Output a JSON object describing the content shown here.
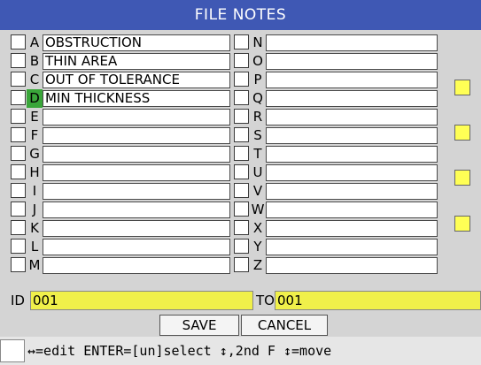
{
  "title": "FILE NOTES",
  "left_notes": [
    {
      "letter": "A",
      "text": "OBSTRUCTION"
    },
    {
      "letter": "B",
      "text": "THIN AREA"
    },
    {
      "letter": "C",
      "text": "OUT OF TOLERANCE"
    },
    {
      "letter": "D",
      "text": "MIN THICKNESS",
      "selected": true
    },
    {
      "letter": "E",
      "text": ""
    },
    {
      "letter": "F",
      "text": ""
    },
    {
      "letter": "G",
      "text": ""
    },
    {
      "letter": "H",
      "text": ""
    },
    {
      "letter": "I",
      "text": ""
    },
    {
      "letter": "J",
      "text": ""
    },
    {
      "letter": "K",
      "text": ""
    },
    {
      "letter": "L",
      "text": ""
    },
    {
      "letter": "M",
      "text": ""
    }
  ],
  "right_notes": [
    {
      "letter": "N",
      "text": ""
    },
    {
      "letter": "O",
      "text": ""
    },
    {
      "letter": "P",
      "text": ""
    },
    {
      "letter": "Q",
      "text": ""
    },
    {
      "letter": "R",
      "text": ""
    },
    {
      "letter": "S",
      "text": ""
    },
    {
      "letter": "T",
      "text": ""
    },
    {
      "letter": "U",
      "text": ""
    },
    {
      "letter": "V",
      "text": ""
    },
    {
      "letter": "W",
      "text": ""
    },
    {
      "letter": "X",
      "text": ""
    },
    {
      "letter": "Y",
      "text": ""
    },
    {
      "letter": "Z",
      "text": ""
    }
  ],
  "id_range": {
    "id_label": "ID",
    "id_value": "001",
    "to_label": "TO",
    "to_value": "001"
  },
  "buttons": {
    "save": "SAVE",
    "cancel": "CANCEL"
  },
  "status": {
    "help_text": "↔=edit ENTER=[un]select ↕,2nd F ↕=move"
  },
  "colors": {
    "title_bar": "#3f58b4",
    "selected_letter": "#3aa63a",
    "id_field": "#f0f04a",
    "indicator": "#ffff55"
  }
}
